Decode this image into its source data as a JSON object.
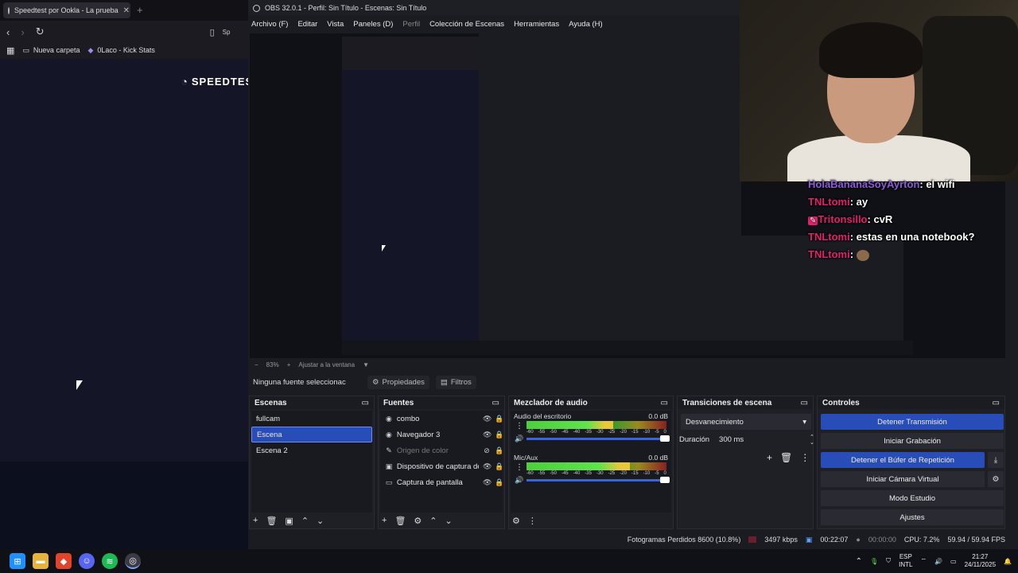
{
  "browser": {
    "tab_title": "Speedtest por Ookla - La prueba",
    "tab_close": "✕",
    "new_tab": "+",
    "bookmarks": [
      "Nueva carpeta",
      "0Laco - Kick Stats"
    ],
    "logo_text": "SPEEDTES",
    "nav_partial": "Sp"
  },
  "obs": {
    "title": "OBS 32.0.1 - Perfil: Sin Título - Escenas: Sin Título",
    "menu": [
      "Archivo (F)",
      "Editar",
      "Vista",
      "Paneles (D)",
      "Perfil",
      "Colección de Escenas",
      "Herramientas",
      "Ayuda (H)"
    ],
    "zoom": {
      "minus": "−",
      "value": "83%",
      "plus": "+",
      "fit": "Ajustar a la ventana"
    },
    "source_bar": {
      "none_selected": "Ninguna fuente seleccionac",
      "properties": "Propiedades",
      "filters": "Filtros"
    },
    "scenes": {
      "title": "Escenas",
      "items": [
        "fullcam",
        "Escena",
        "Escena 2"
      ],
      "selected_index": 1
    },
    "sources": {
      "title": "Fuentes",
      "items": [
        "combo",
        "Navegador 3",
        "Origen de color",
        "Dispositivo de captura de",
        "Captura de pantalla"
      ]
    },
    "mixer": {
      "title": "Mezclador de audio",
      "tracks": [
        {
          "name": "Audio del escritorio",
          "db": "0.0 dB",
          "level": 0.62
        },
        {
          "name": "Mic/Aux",
          "db": "0.0 dB",
          "level": 0.74
        }
      ],
      "ticks": [
        "-60",
        "-55",
        "-50",
        "-45",
        "-40",
        "-35",
        "-30",
        "-25",
        "-20",
        "-15",
        "-10",
        "-5",
        "0"
      ]
    },
    "transitions": {
      "title": "Transiciones de escena",
      "selected": "Desvanecimiento",
      "duration_label": "Duración",
      "duration_value": "300 ms"
    },
    "controls": {
      "title": "Controles",
      "buttons": [
        "Detener Transmisión",
        "Iniciar Grabación",
        "Detener el Búfer de Repetición",
        "Iniciar Cámara Virtual",
        "Modo Estudio",
        "Ajustes"
      ]
    },
    "status": {
      "dropped": "Fotogramas Perdidos 8600 (10.8%)",
      "kbps": "3497 kbps",
      "stream_time": "00:22:07",
      "rec_time": "00:00:00",
      "cpu": "CPU: 7.2%",
      "fps": "59.94 / 59.94 FPS"
    }
  },
  "chat": [
    {
      "user": "HolaBananaSoyAyrton",
      "msg": ": el wifi"
    },
    {
      "user": "TNLtomi",
      "msg": ": ay"
    },
    {
      "user": "Tritonsillo",
      "msg": ": cvR"
    },
    {
      "user": "TNLtomi",
      "msg": ": estas en una notebook?"
    },
    {
      "user": "TNLtomi",
      "msg": ":"
    }
  ],
  "taskbar": {
    "lang_top": "ESP",
    "lang_bottom": "INTL",
    "time": "21:27",
    "date": "24/11/2025"
  },
  "colors": {
    "accent": "#284cb8",
    "chat_user": "#e3206d"
  }
}
